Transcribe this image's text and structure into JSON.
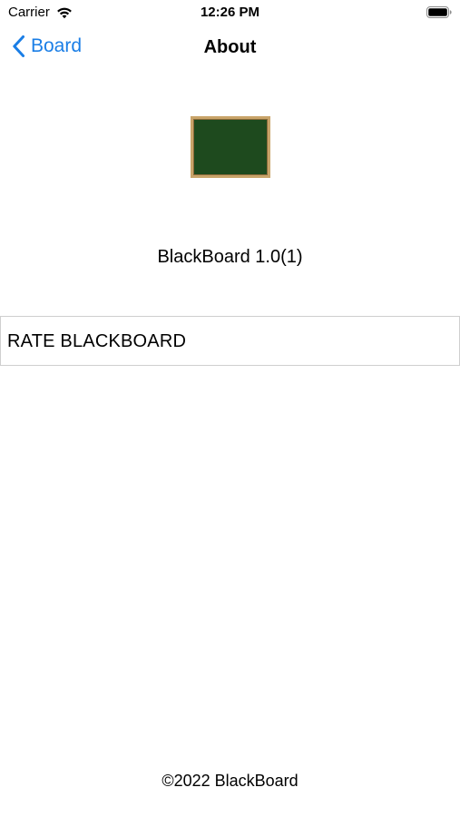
{
  "status_bar": {
    "carrier": "Carrier",
    "time": "12:26 PM",
    "wifi_icon": "wifi-icon",
    "battery_icon": "battery-icon"
  },
  "nav": {
    "back_label": "Board",
    "back_icon": "chevron-left-icon",
    "title": "About"
  },
  "app": {
    "version": "BlackBoard 1.0(1)",
    "rate_label": "RATE BLACKBOARD",
    "copyright": "©2022 BlackBoard"
  },
  "colors": {
    "accent": "#1a7ee6",
    "board_green": "#1e4a1e",
    "board_frame": "#c9a46a"
  }
}
